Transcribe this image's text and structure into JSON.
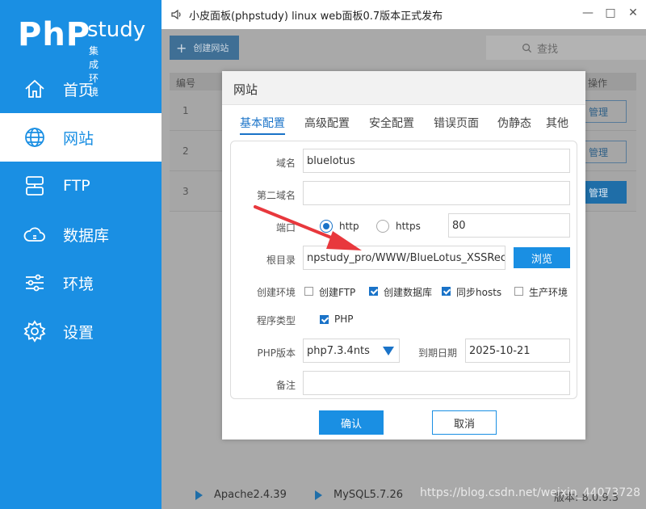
{
  "sidebar": {
    "logo_php": "PhP",
    "logo_study": "study",
    "logo_sub": "集成环境",
    "items": [
      {
        "label": "首页",
        "icon": "home-icon",
        "active": false
      },
      {
        "label": "网站",
        "icon": "globe-icon",
        "active": true
      },
      {
        "label": "FTP",
        "icon": "ftp-icon",
        "active": false
      },
      {
        "label": "数据库",
        "icon": "database-icon",
        "active": false
      },
      {
        "label": "环境",
        "icon": "sliders-icon",
        "active": false
      },
      {
        "label": "设置",
        "icon": "gear-icon",
        "active": false
      }
    ]
  },
  "titlebar": {
    "title": "小皮面板(phpstudy) linux web面板0.7版本正式发布",
    "min": "—",
    "max": "□",
    "close": "✕"
  },
  "toolbar": {
    "create_label": "创建网站",
    "search_placeholder": "查找"
  },
  "table": {
    "col_num": "编号",
    "col_action": "操作",
    "rows": [
      {
        "num": "1",
        "action": "管理"
      },
      {
        "num": "2",
        "action": "管理"
      },
      {
        "num": "3",
        "action": "管理"
      }
    ]
  },
  "dialog": {
    "title": "网站",
    "tabs": [
      "基本配置",
      "高级配置",
      "安全配置",
      "错误页面",
      "伪静态",
      "其他"
    ],
    "labels": {
      "domain": "域名",
      "second_domain": "第二域名",
      "port": "端口",
      "root": "根目录",
      "create_env": "创建环境",
      "program_type": "程序类型",
      "php_version": "PHP版本",
      "expire": "到期日期",
      "note": "备注"
    },
    "values": {
      "domain": "bluelotus",
      "second_domain": "",
      "port": "80",
      "root": "npstudy_pro/WWW/BlueLotus_XSSReceiver",
      "php_version": "php7.3.4nts",
      "expire": "2025-10-21",
      "note": ""
    },
    "protocols": [
      {
        "label": "http",
        "selected": true
      },
      {
        "label": "https",
        "selected": false
      }
    ],
    "browse_label": "浏览",
    "env_options": [
      {
        "label": "创建FTP",
        "checked": false
      },
      {
        "label": "创建数据库",
        "checked": true
      },
      {
        "label": "同步hosts",
        "checked": true
      },
      {
        "label": "生产环境",
        "checked": false
      }
    ],
    "program_options": [
      {
        "label": "PHP",
        "checked": true
      }
    ],
    "ok_label": "确认",
    "cancel_label": "取消"
  },
  "footer": {
    "services": [
      "Apache2.4.39",
      "MySQL5.7.26"
    ],
    "version": "版本: 8.0.9.3"
  },
  "watermark": "https://blog.csdn.net/weixin_44073728",
  "colors": {
    "accent": "#1a8fe3",
    "arrow": "#e8383d"
  }
}
